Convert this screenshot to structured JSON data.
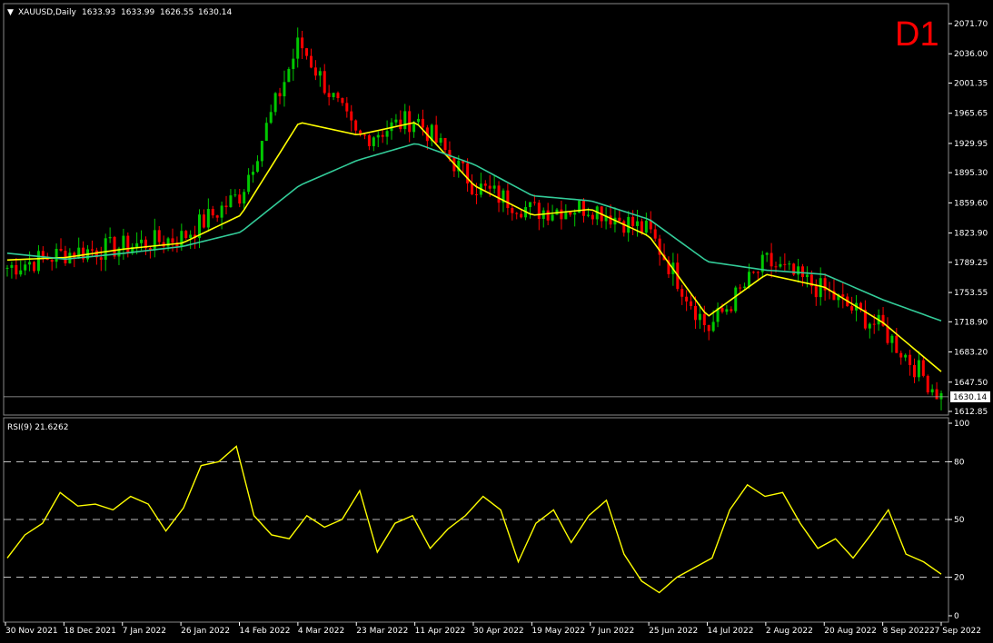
{
  "header": {
    "symbol": "XAUUSD,Daily",
    "open": "1633.93",
    "high": "1633.99",
    "low": "1626.55",
    "close": "1630.14"
  },
  "timeframe_badge": "D1",
  "price_axis": {
    "ticks": [
      "2071.70",
      "2036.00",
      "2001.35",
      "1965.65",
      "1929.95",
      "1895.30",
      "1859.60",
      "1823.90",
      "1789.25",
      "1753.55",
      "1718.90",
      "1683.20",
      "1647.50",
      "1612.85"
    ],
    "current_price_label": "1630.14"
  },
  "rsi_panel": {
    "label": "RSI(9) 21.6262",
    "axis_ticks": [
      "100",
      "80",
      "50",
      "20",
      "0"
    ]
  },
  "date_axis": [
    "30 Nov 2021",
    "18 Dec 2021",
    "7 Jan 2022",
    "26 Jan 2022",
    "14 Feb 2022",
    "4 Mar 2022",
    "23 Mar 2022",
    "11 Apr 2022",
    "30 Apr 2022",
    "19 May 2022",
    "7 Jun 2022",
    "25 Jun 2022",
    "14 Jul 2022",
    "2 Aug 2022",
    "20 Aug 2022",
    "8 Sep 2022",
    "27 Sep 2022"
  ],
  "colors": {
    "bull": "#00c800",
    "bear": "#ff0000",
    "fast_ma": "#ffff00",
    "slow_ma": "#33cc99",
    "rsi_line": "#ffff00",
    "grid": "#ffffff"
  },
  "chart_data": {
    "type": "line",
    "title": "XAUUSD,Daily",
    "ylim": [
      1612.85,
      2071.7
    ],
    "dates": [
      "30 Nov 2021",
      "18 Dec 2021",
      "7 Jan 2022",
      "26 Jan 2022",
      "14 Feb 2022",
      "4 Mar 2022",
      "23 Mar 2022",
      "11 Apr 2022",
      "30 Apr 2022",
      "19 May 2022",
      "7 Jun 2022",
      "25 Jun 2022",
      "14 Jul 2022",
      "2 Aug 2022",
      "20 Aug 2022",
      "8 Sep 2022",
      "27 Sep 2022"
    ],
    "series": [
      {
        "name": "",
        "values": [
          1783,
          1800,
          1808,
          1819,
          1870,
          2050,
          1935,
          1960,
          1880,
          1850,
          1855,
          1825,
          1710,
          1790,
          1755,
          1710,
          1630
        ]
      },
      {
        "name": "",
        "values": [
          1792,
          1795,
          1805,
          1812,
          1845,
          1955,
          1940,
          1955,
          1880,
          1845,
          1852,
          1820,
          1725,
          1775,
          1760,
          1718,
          1660
        ]
      },
      {
        "name": "",
        "values": [
          1800,
          1793,
          1800,
          1808,
          1825,
          1880,
          1910,
          1930,
          1905,
          1868,
          1862,
          1840,
          1790,
          1780,
          1775,
          1745,
          1720
        ]
      }
    ],
    "rsi": {
      "ylim": [
        0,
        100
      ],
      "levels": [
        80,
        50,
        20
      ],
      "values": [
        30,
        42,
        48,
        64,
        57,
        58,
        55,
        62,
        58,
        44,
        56,
        78,
        80,
        88,
        52,
        42,
        40,
        52,
        46,
        50,
        65,
        33,
        48,
        52,
        35,
        45,
        52,
        62,
        55,
        28,
        48,
        55,
        38,
        52,
        60,
        32,
        18,
        12,
        20,
        25,
        30,
        55,
        68,
        62,
        64,
        48,
        35,
        40,
        30,
        42,
        55,
        32,
        28,
        21.6
      ]
    }
  }
}
